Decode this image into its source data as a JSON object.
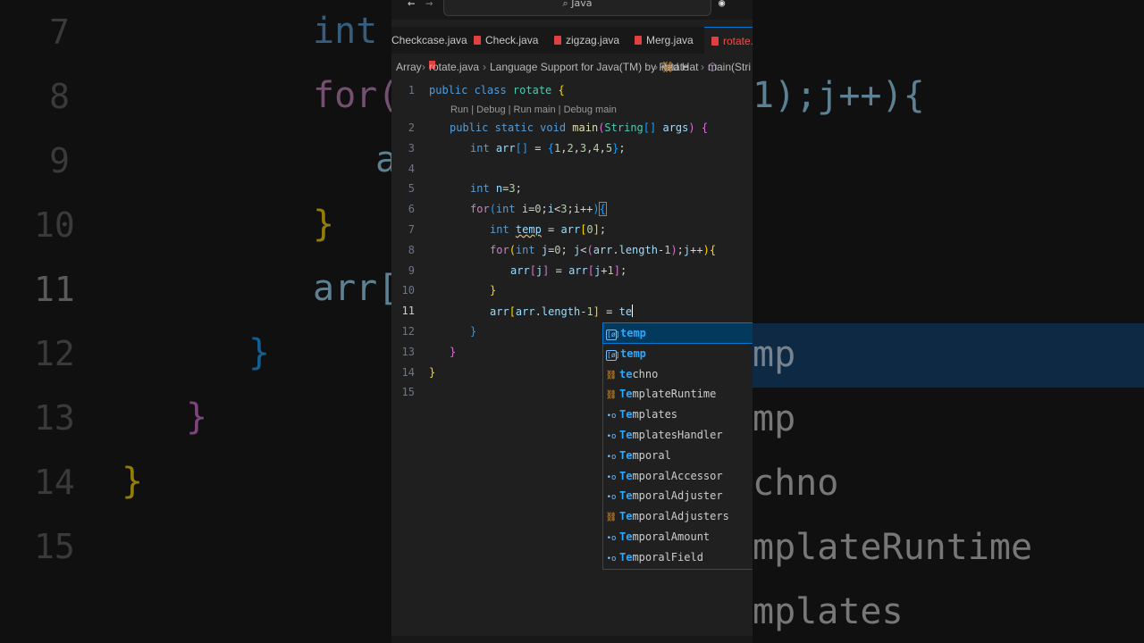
{
  "background": {
    "left_line_numbers": [
      "7",
      "8",
      "9",
      "10",
      "11",
      "12",
      "13",
      "14",
      "15"
    ],
    "right_suggest_echo": [
      "mp",
      "mp",
      "chno",
      "mplateRuntime",
      "mplates"
    ]
  },
  "titlebar": {
    "search_text": "Java",
    "back": "←",
    "forward": "→"
  },
  "tabs": [
    {
      "label": "Checkcase.java",
      "active": false
    },
    {
      "label": "Check.java",
      "active": false
    },
    {
      "label": "zigzag.java",
      "active": false
    },
    {
      "label": "Merg.java",
      "active": false
    },
    {
      "label": "rotate.ja",
      "active": true
    }
  ],
  "breadcrumb": {
    "folder": "Array",
    "file": "rotate.java",
    "lang": "Language Support for Java(TM) by Red Hat",
    "class": "rotate",
    "method": "main(Stri"
  },
  "codelens": "Run | Debug | Run main | Debug main",
  "line_numbers": [
    "1",
    "2",
    "3",
    "4",
    "5",
    "6",
    "7",
    "8",
    "9",
    "10",
    "11",
    "12",
    "13",
    "14",
    "15"
  ],
  "current_line": "11",
  "suggestions": [
    {
      "match": "temp",
      "rest": "",
      "kind": "variable",
      "selected": true
    },
    {
      "match": "temp",
      "rest": "",
      "kind": "variable",
      "selected": false
    },
    {
      "match": "te",
      "rest": "chno",
      "kind": "class",
      "selected": false
    },
    {
      "match": "Te",
      "rest": "mplateRuntime",
      "kind": "class",
      "selected": false
    },
    {
      "match": "Te",
      "rest": "mplates",
      "kind": "interface",
      "selected": false
    },
    {
      "match": "Te",
      "rest": "mplatesHandler",
      "kind": "interface",
      "selected": false
    },
    {
      "match": "Te",
      "rest": "mporal",
      "kind": "interface",
      "selected": false
    },
    {
      "match": "Te",
      "rest": "mporalAccessor",
      "kind": "interface",
      "selected": false
    },
    {
      "match": "Te",
      "rest": "mporalAdjuster",
      "kind": "interface",
      "selected": false
    },
    {
      "match": "Te",
      "rest": "mporalAdjusters",
      "kind": "class",
      "selected": false
    },
    {
      "match": "Te",
      "rest": "mporalAmount",
      "kind": "interface",
      "selected": false
    },
    {
      "match": "Te",
      "rest": "mporalField",
      "kind": "interface",
      "selected": false
    }
  ]
}
